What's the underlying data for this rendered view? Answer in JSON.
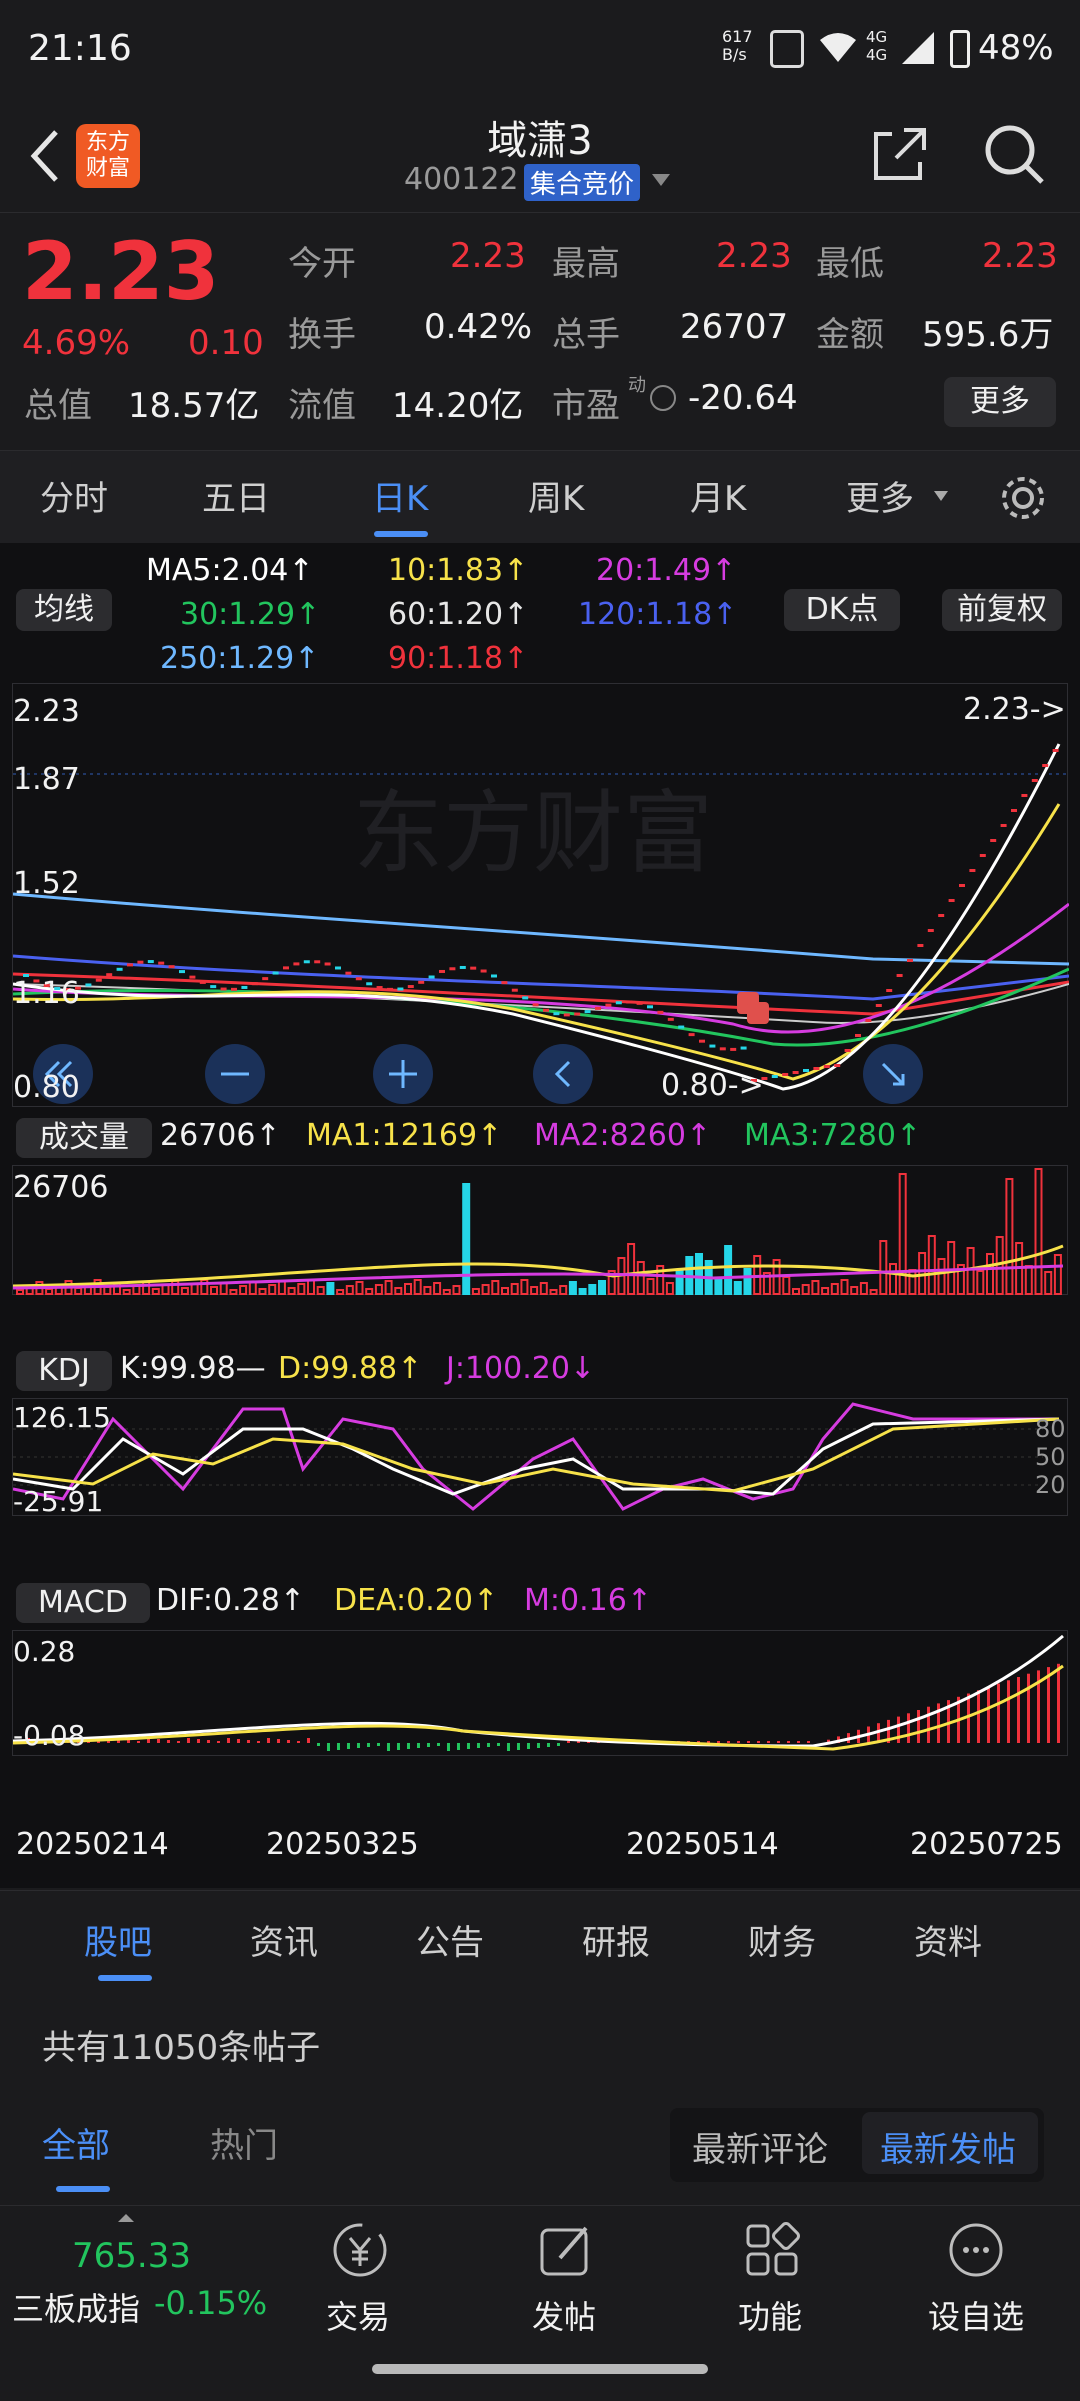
{
  "status_bar": {
    "time": "21:16",
    "net_speed": "617\nB/s",
    "network": "4G 4G",
    "battery": "48%"
  },
  "header": {
    "title": "域潇3",
    "code": "400122",
    "tag": "集合竞价",
    "logo_text": "东方\n财富"
  },
  "quote": {
    "price": "2.23",
    "pct": "4.69%",
    "change": "0.10",
    "open_label": "今开",
    "open": "2.23",
    "high_label": "最高",
    "high": "2.23",
    "low_label": "最低",
    "low": "2.23",
    "turnover_label": "换手",
    "turnover": "0.42%",
    "volume_label": "总手",
    "volume": "26707",
    "amount_label": "金额",
    "amount": "595.6万",
    "mktcap_label": "总值",
    "mktcap": "18.57亿",
    "float_label": "流值",
    "float": "14.20亿",
    "pe_label": "市盈",
    "pe_sup": "动",
    "pe": "-20.64",
    "more_btn": "更多"
  },
  "tabs": [
    "分时",
    "五日",
    "日K",
    "周K",
    "月K",
    "更多"
  ],
  "active_tab": "日K",
  "ma_legend": {
    "selector": "均线",
    "items": [
      {
        "text": "MA5:2.04↑",
        "color": "#ffffff"
      },
      {
        "text": "10:1.83↑",
        "color": "#f7e24a"
      },
      {
        "text": "20:1.49↑",
        "color": "#d63ce0"
      },
      {
        "text": "30:1.29↑",
        "color": "#22c55e"
      },
      {
        "text": "60:1.20↑",
        "color": "#e6e6e6"
      },
      {
        "text": "120:1.18↑",
        "color": "#4a61f0"
      },
      {
        "text": "250:1.29↑",
        "color": "#6fb8ff"
      },
      {
        "text": "90:1.18↑",
        "color": "#f0323c"
      }
    ],
    "dk_btn": "DK点",
    "adj_btn": "前复权"
  },
  "kline_axis": {
    "ticks": [
      "2.23",
      "1.87",
      "1.52",
      "1.16",
      "0.80"
    ],
    "last_label": "2.23->",
    "low_label": "0.80->"
  },
  "volume_legend": {
    "selector": "成交量",
    "vol": "26706↑",
    "ma1": "MA1:12169↑",
    "ma2": "MA2:8260↑",
    "ma3": "MA3:7280↑",
    "axis_max": "26706"
  },
  "kdj_legend": {
    "selector": "KDJ",
    "k": "K:99.98—",
    "d": "D:99.88↑",
    "j": "J:100.20↓",
    "axis_max": "126.15",
    "axis_min": "-25.91",
    "levels": [
      "80",
      "50",
      "20"
    ]
  },
  "macd_legend": {
    "selector": "MACD",
    "dif": "DIF:0.28↑",
    "dea": "DEA:0.20↑",
    "m": "M:0.16↑",
    "axis_max": "0.28",
    "axis_min": "-0.08"
  },
  "dates": [
    "20250214",
    "20250325",
    "20250514",
    "20250725"
  ],
  "bottom_tabs": [
    "股吧",
    "资讯",
    "公告",
    "研报",
    "财务",
    "资料"
  ],
  "active_bottom_tab": "股吧",
  "posts": {
    "count_text": "共有11050条帖子",
    "filter_all": "全部",
    "filter_hot": "热门",
    "sort_comment": "最新评论",
    "sort_post": "最新发帖"
  },
  "nav": {
    "index_value": "765.33",
    "index_name": "三板成指",
    "index_pct": "-0.15%",
    "items": [
      {
        "label": "交易",
        "icon": "yuan-icon"
      },
      {
        "label": "发帖",
        "icon": "edit-icon"
      },
      {
        "label": "功能",
        "icon": "grid-icon"
      },
      {
        "label": "设自选",
        "icon": "more-icon"
      }
    ]
  },
  "chart_data": {
    "type": "candlestick",
    "title": "域潇3 日K",
    "x_ticks": [
      "20250214",
      "20250325",
      "20250514",
      "20250725"
    ],
    "y_range": [
      0.8,
      2.23
    ],
    "last_close": 2.23,
    "period_low": 0.8,
    "volume_max": 26706,
    "kdj_range": [
      -25.91,
      126.15
    ],
    "macd_range": [
      -0.08,
      0.28
    ]
  }
}
